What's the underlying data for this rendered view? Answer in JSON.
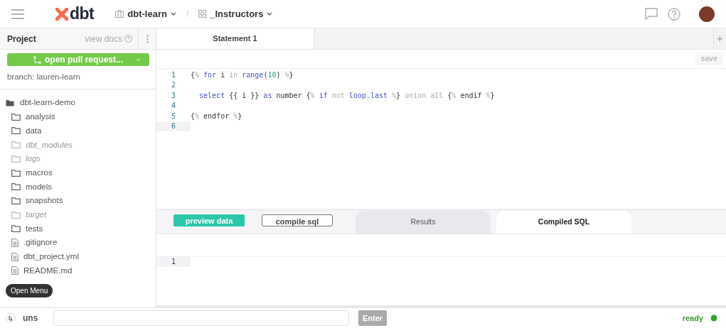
{
  "header": {
    "logo": "dbt",
    "breadcrumbs": [
      {
        "label": "dbt-learn",
        "kind": "repo"
      },
      {
        "label": "_Instructors",
        "kind": "grid"
      }
    ],
    "separator": "/"
  },
  "sidebar": {
    "title": "Project",
    "docs_link": "view docs",
    "pr_button": "open pull request...",
    "branch": "branch: lauren-learn",
    "tree": [
      {
        "label": "dbt-learn-demo",
        "kind": "folder",
        "expanded": true,
        "ignored": false,
        "children": [
          {
            "label": "analysis",
            "kind": "folder",
            "expanded": false,
            "ignored": false
          },
          {
            "label": "data",
            "kind": "folder",
            "expanded": false,
            "ignored": false
          },
          {
            "label": "dbt_modules",
            "kind": "folder",
            "expanded": false,
            "ignored": true
          },
          {
            "label": "logs",
            "kind": "folder",
            "expanded": false,
            "ignored": true
          },
          {
            "label": "macros",
            "kind": "folder",
            "expanded": false,
            "ignored": false
          },
          {
            "label": "models",
            "kind": "folder",
            "expanded": false,
            "ignored": false
          },
          {
            "label": "snapshots",
            "kind": "folder",
            "expanded": false,
            "ignored": false
          },
          {
            "label": "target",
            "kind": "folder",
            "expanded": false,
            "ignored": true
          },
          {
            "label": "tests",
            "kind": "folder",
            "expanded": false,
            "ignored": false
          },
          {
            "label": ".gitignore",
            "kind": "file",
            "expanded": false,
            "ignored": false
          },
          {
            "label": "dbt_project.yml",
            "kind": "file",
            "expanded": false,
            "ignored": false
          },
          {
            "label": "README.md",
            "kind": "file",
            "expanded": false,
            "ignored": false
          }
        ]
      }
    ],
    "menu_button": "Open Menu"
  },
  "editor": {
    "tabs": [
      {
        "label": "Statement 1",
        "selected": true
      }
    ],
    "add_tab": "+",
    "save_button": "save",
    "lines": [
      {
        "number": "1",
        "current": false,
        "tokens": [
          {
            "text": "{",
            "kind": "plain"
          },
          {
            "text": "%",
            "kind": "muted"
          },
          {
            "text": " for",
            "kind": "keyword"
          },
          {
            "text": " i ",
            "kind": "plain"
          },
          {
            "text": "in",
            "kind": "muted"
          },
          {
            "text": " range",
            "kind": "keyword"
          },
          {
            "text": "(",
            "kind": "plain"
          },
          {
            "text": "10",
            "kind": "number"
          },
          {
            "text": ") ",
            "kind": "plain"
          },
          {
            "text": "%",
            "kind": "muted"
          },
          {
            "text": "}",
            "kind": "plain"
          }
        ]
      },
      {
        "number": "2",
        "current": false
      },
      {
        "number": "3",
        "current": false,
        "tokens": [
          {
            "text": "  select",
            "kind": "keyword"
          },
          {
            "text": " {{ i }} ",
            "kind": "plain"
          },
          {
            "text": "as",
            "kind": "keyword"
          },
          {
            "text": " number {",
            "kind": "plain"
          },
          {
            "text": "%",
            "kind": "muted"
          },
          {
            "text": " if",
            "kind": "keyword"
          },
          {
            "text": " not",
            "kind": "muted"
          },
          {
            "text": " loop.last",
            "kind": "keyword"
          },
          {
            "text": " %",
            "kind": "muted"
          },
          {
            "text": "} ",
            "kind": "plain"
          },
          {
            "text": "union all",
            "kind": "muted"
          },
          {
            "text": " {",
            "kind": "plain"
          },
          {
            "text": "%",
            "kind": "muted"
          },
          {
            "text": " endif ",
            "kind": "plain"
          },
          {
            "text": "%",
            "kind": "muted"
          },
          {
            "text": "}",
            "kind": "plain"
          }
        ]
      },
      {
        "number": "4",
        "current": false
      },
      {
        "number": "5",
        "current": false,
        "tokens": [
          {
            "text": "{",
            "kind": "plain"
          },
          {
            "text": "%",
            "kind": "muted"
          },
          {
            "text": " endfor ",
            "kind": "plain"
          },
          {
            "text": "%",
            "kind": "muted"
          },
          {
            "text": "}",
            "kind": "plain"
          }
        ]
      },
      {
        "number": "6",
        "current": true
      }
    ]
  },
  "results": {
    "preview_button": "preview data",
    "compile_button": "compile sql",
    "tabs": [
      {
        "label": "Results",
        "selected": false
      },
      {
        "label": "Compiled SQL",
        "selected": true
      }
    ],
    "lines": [
      {
        "number": "1"
      }
    ]
  },
  "status_bar": {
    "label": "uns",
    "enter_button": "Enter",
    "status": "ready"
  }
}
